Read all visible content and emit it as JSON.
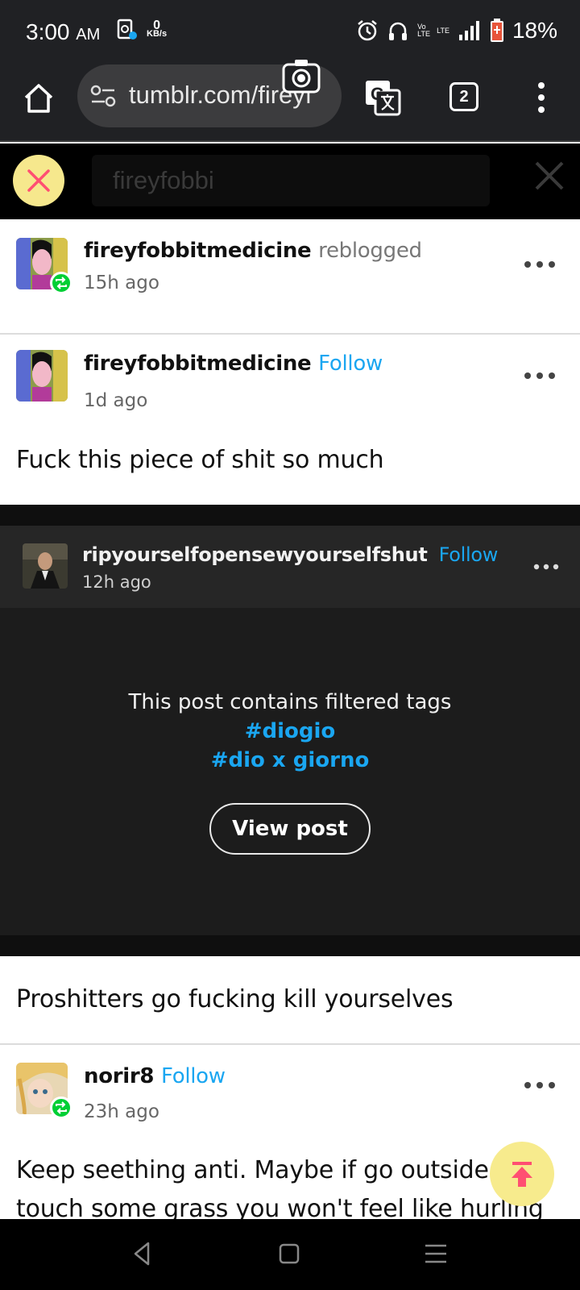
{
  "status_bar": {
    "time": "3:00",
    "ampm": "AM",
    "net_speed_value": "0",
    "net_speed_unit": "KB/s",
    "volte": "Vo LTE",
    "lte": "LTE",
    "battery_percent": "18%"
  },
  "browser": {
    "url": "tumblr.com/fireyf",
    "tab_count": "2"
  },
  "search": {
    "query": "fireyfobbi"
  },
  "posts": [
    {
      "username": "fireyfobbitmedicine",
      "action": "reblogged",
      "time": "15h ago"
    },
    {
      "username": "fireyfobbitmedicine",
      "follow": "Follow",
      "time": "1d ago",
      "text": "Fuck this piece of shit so much"
    },
    {
      "username": "ripyourselfopensewyourselfshut",
      "follow": "Follow",
      "time": "12h ago",
      "filter_message": "This post contains filtered tags",
      "tags": [
        "#diogio",
        "#dio x giorno"
      ],
      "view_button": "View post"
    },
    {
      "text": "Proshitters go fucking kill yourselves"
    },
    {
      "username": "norir8",
      "follow": "Follow",
      "time": "23h ago",
      "text_line1": "Keep seething anti. Maybe if go outside a",
      "text_line2": "touch some grass you won't feel like hurling"
    }
  ],
  "colors": {
    "follow_blue": "#1aa6f1",
    "reblog_green": "#00cf35",
    "accent_yellow": "#f6e88d",
    "close_pink": "#ff4f72"
  }
}
